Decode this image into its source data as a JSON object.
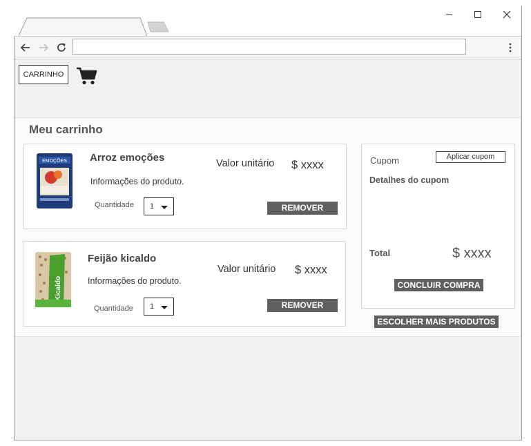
{
  "browser": {
    "address": "",
    "back_icon": "arrow-left-icon",
    "forward_icon": "arrow-right-icon",
    "reload_icon": "reload-icon",
    "menu_icon": "vertical-dots-icon"
  },
  "header": {
    "cart_button_label": "CARRINHO",
    "cart_icon": "shopping-cart-icon"
  },
  "cart": {
    "title": "Meu carrinho",
    "items": [
      {
        "name": "Arroz emoções",
        "info": "Informações do produto.",
        "unit_label": "Valor unitário",
        "price": "$ xxxx",
        "quantity_label": "Quantidade",
        "quantity": "1",
        "remove_label": "REMOVER",
        "image": "rice-package-image"
      },
      {
        "name": "Feijão kicaldo",
        "info": "Informações do produto.",
        "unit_label": "Valor unitário",
        "price": "$ xxxx",
        "quantity_label": "Quantidade",
        "quantity": "1",
        "remove_label": "REMOVER",
        "image": "beans-package-image"
      }
    ]
  },
  "coupon": {
    "label": "Cupom",
    "apply_label": "Aplicar cupom",
    "details_label": "Detalhes do cupom",
    "total_label": "Total",
    "total_value": "$ xxxx",
    "checkout_label": "CONCLUIR COMPRA",
    "more_products_label": "ESCOLHER MAIS PRODUTOS"
  },
  "colors": {
    "button_dark": "#5f5f5f",
    "page_bg": "#f1f1f1"
  }
}
